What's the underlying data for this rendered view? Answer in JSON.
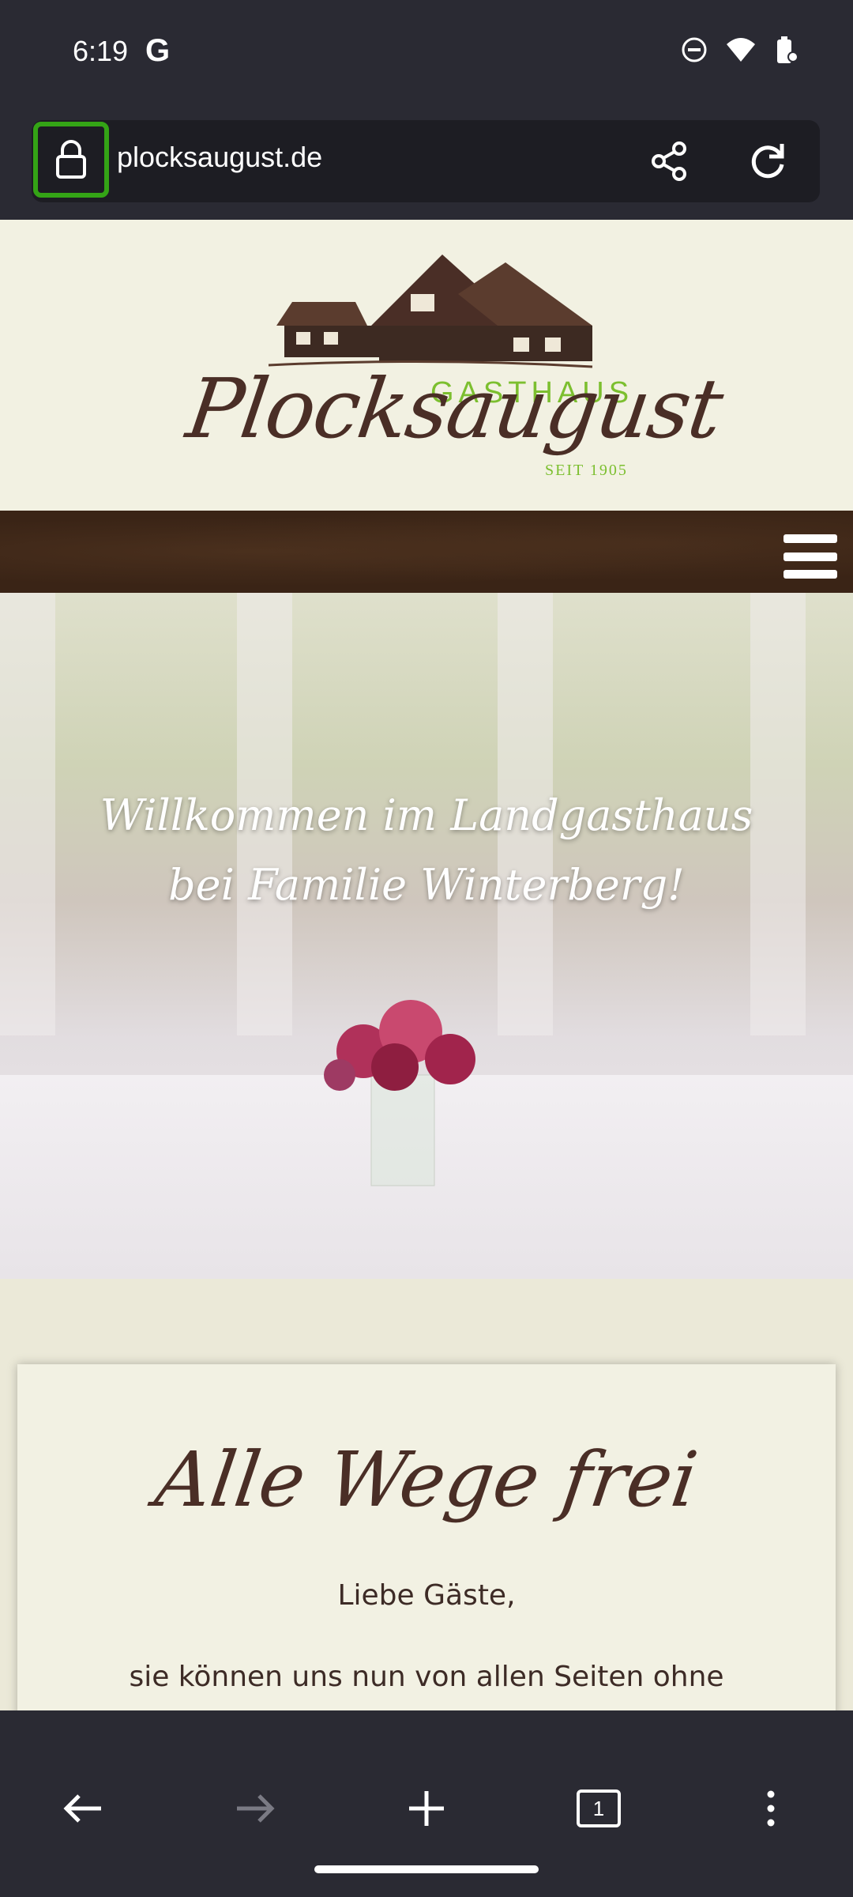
{
  "status_bar": {
    "time": "6:19",
    "google_letter": "G"
  },
  "browser": {
    "url": "plocksaugust.de"
  },
  "header": {
    "label_top": "GASTHAUS",
    "brand": "Plocksaugust",
    "since": "SEIT 1905"
  },
  "hero": {
    "line1": "Willkommen im Landgasthaus",
    "line2": "bei Familie Winterberg!"
  },
  "notice": {
    "title": "Alle Wege frei",
    "greeting": "Liebe Gäste,",
    "body": "sie können uns nun von allen Seiten ohne Sperrung anfahren."
  },
  "tabs": {
    "count": "1"
  },
  "colors": {
    "accent_green": "#7cbf2f",
    "brand_brown": "#4a2e26",
    "lock_highlight": "#34a416"
  }
}
